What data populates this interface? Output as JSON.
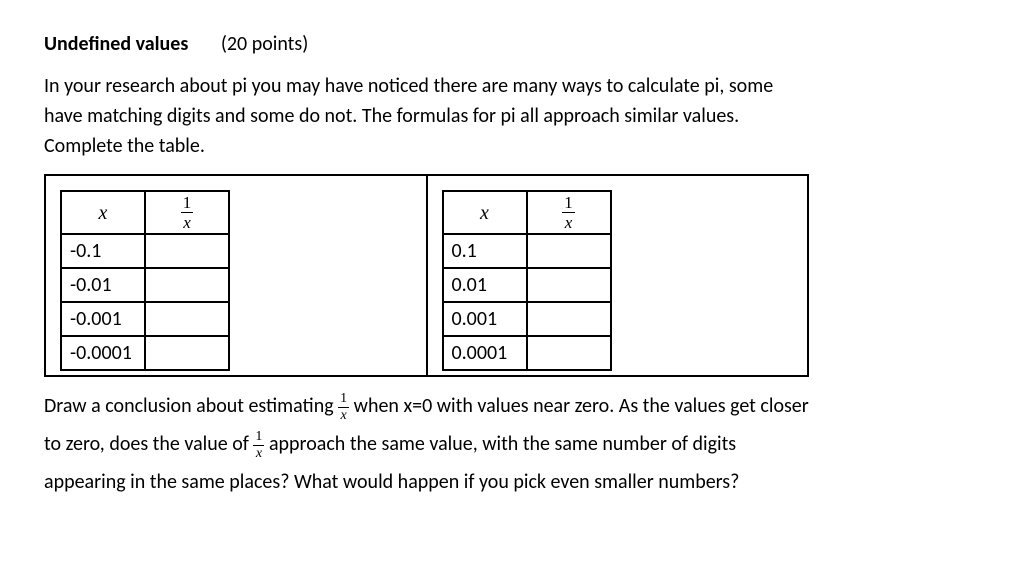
{
  "title": {
    "label": "Undefined values",
    "points": "(20 points)"
  },
  "intro": {
    "line1": "In your research about pi you may have noticed there are many ways to calculate pi, some",
    "line2": "have matching digits and some do not.  The formulas for pi all approach similar values.",
    "line3": "Complete the table."
  },
  "table_headers": {
    "x": "x",
    "frac_num": "1",
    "frac_den": "x"
  },
  "tables": {
    "left": {
      "rows": [
        {
          "x": "-0.1",
          "f": ""
        },
        {
          "x": "-0.01",
          "f": ""
        },
        {
          "x": "-0.001",
          "f": ""
        },
        {
          "x": "-0.0001",
          "f": ""
        }
      ]
    },
    "right": {
      "rows": [
        {
          "x": "0.1",
          "f": ""
        },
        {
          "x": "0.01",
          "f": ""
        },
        {
          "x": "0.001",
          "f": ""
        },
        {
          "x": "0.0001",
          "f": ""
        }
      ]
    }
  },
  "conclusion": {
    "part1a": "Draw a conclusion about estimating ",
    "part1b": " when x=0 with values near zero.  As the values get closer",
    "part2a": "to zero, does the value of ",
    "part2b": " approach the same value, with the same number of digits",
    "part3": "appearing in the same places?  What would happen if you pick even smaller numbers?",
    "frac_num": "1",
    "frac_den": "x"
  }
}
